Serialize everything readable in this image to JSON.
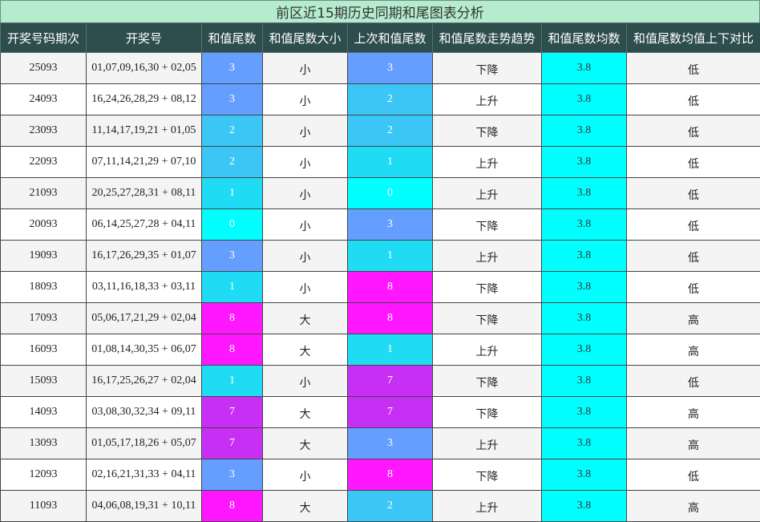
{
  "title": "前区近15期历史同期和尾图表分析",
  "headers": [
    "开奖号码期次",
    "开奖号",
    "和值尾数",
    "和值尾数大小",
    "上次和值尾数",
    "和值尾数走势趋势",
    "和值尾数均数",
    "和值尾数均值上下对比"
  ],
  "digit_colors": {
    "0": "#00ffff",
    "1": "#1fdcf4",
    "2": "#3cc6f6",
    "3": "#649fff",
    "7": "#c72ff4",
    "8": "#ff18ff"
  },
  "rows": [
    {
      "period": "25093",
      "numbers": "01,07,09,16,30 + 02,05",
      "tail": "3",
      "size": "小",
      "prev_tail": "3",
      "trend": "下降",
      "avg": "3.8",
      "compare": "低"
    },
    {
      "period": "24093",
      "numbers": "16,24,26,28,29 + 08,12",
      "tail": "3",
      "size": "小",
      "prev_tail": "2",
      "trend": "上升",
      "avg": "3.8",
      "compare": "低"
    },
    {
      "period": "23093",
      "numbers": "11,14,17,19,21 + 01,05",
      "tail": "2",
      "size": "小",
      "prev_tail": "2",
      "trend": "下降",
      "avg": "3.8",
      "compare": "低"
    },
    {
      "period": "22093",
      "numbers": "07,11,14,21,29 + 07,10",
      "tail": "2",
      "size": "小",
      "prev_tail": "1",
      "trend": "上升",
      "avg": "3.8",
      "compare": "低"
    },
    {
      "period": "21093",
      "numbers": "20,25,27,28,31 + 08,11",
      "tail": "1",
      "size": "小",
      "prev_tail": "0",
      "trend": "上升",
      "avg": "3.8",
      "compare": "低"
    },
    {
      "period": "20093",
      "numbers": "06,14,25,27,28 + 04,11",
      "tail": "0",
      "size": "小",
      "prev_tail": "3",
      "trend": "下降",
      "avg": "3.8",
      "compare": "低"
    },
    {
      "period": "19093",
      "numbers": "16,17,26,29,35 + 01,07",
      "tail": "3",
      "size": "小",
      "prev_tail": "1",
      "trend": "上升",
      "avg": "3.8",
      "compare": "低"
    },
    {
      "period": "18093",
      "numbers": "03,11,16,18,33 + 03,11",
      "tail": "1",
      "size": "小",
      "prev_tail": "8",
      "trend": "下降",
      "avg": "3.8",
      "compare": "低"
    },
    {
      "period": "17093",
      "numbers": "05,06,17,21,29 + 02,04",
      "tail": "8",
      "size": "大",
      "prev_tail": "8",
      "trend": "下降",
      "avg": "3.8",
      "compare": "高"
    },
    {
      "period": "16093",
      "numbers": "01,08,14,30,35 + 06,07",
      "tail": "8",
      "size": "大",
      "prev_tail": "1",
      "trend": "上升",
      "avg": "3.8",
      "compare": "高"
    },
    {
      "period": "15093",
      "numbers": "16,17,25,26,27 + 02,04",
      "tail": "1",
      "size": "小",
      "prev_tail": "7",
      "trend": "下降",
      "avg": "3.8",
      "compare": "低"
    },
    {
      "period": "14093",
      "numbers": "03,08,30,32,34 + 09,11",
      "tail": "7",
      "size": "大",
      "prev_tail": "7",
      "trend": "下降",
      "avg": "3.8",
      "compare": "高"
    },
    {
      "period": "13093",
      "numbers": "01,05,17,18,26 + 05,07",
      "tail": "7",
      "size": "大",
      "prev_tail": "3",
      "trend": "上升",
      "avg": "3.8",
      "compare": "高"
    },
    {
      "period": "12093",
      "numbers": "02,16,21,31,33 + 04,11",
      "tail": "3",
      "size": "小",
      "prev_tail": "8",
      "trend": "下降",
      "avg": "3.8",
      "compare": "低"
    },
    {
      "period": "11093",
      "numbers": "04,06,08,19,31 + 10,11",
      "tail": "8",
      "size": "大",
      "prev_tail": "2",
      "trend": "上升",
      "avg": "3.8",
      "compare": "高"
    }
  ]
}
